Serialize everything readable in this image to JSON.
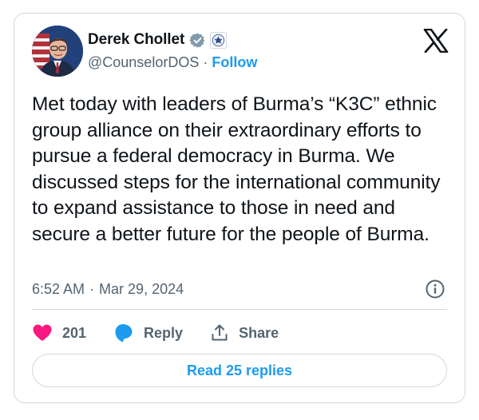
{
  "author": {
    "name": "Derek Chollet",
    "handle": "@CounselorDOS",
    "separator": "·",
    "follow_label": "Follow"
  },
  "icons": {
    "verified": "verified-badge-icon",
    "government": "government-seal-icon",
    "platform": "x-logo-icon",
    "info": "info-icon",
    "like": "heart-icon",
    "reply": "reply-bubble-icon",
    "share": "share-icon"
  },
  "tweet": {
    "text": "Met today with leaders of Burma’s “K3C” ethnic group alliance on their extraordinary efforts to pursue a federal democracy in Burma. We discussed steps for the international community to expand assistance to those in need and secure a better future for the people of Burma.",
    "time": "6:52 AM",
    "separator": "·",
    "date": "Mar 29, 2024"
  },
  "actions": {
    "like_count": "201",
    "reply_label": "Reply",
    "share_label": "Share"
  },
  "footer": {
    "read_replies_label": "Read 25 replies"
  },
  "colors": {
    "accent": "#1d9bf0",
    "like": "#f91880",
    "text": "#0f1419",
    "muted": "#536471",
    "border": "#cfd9de"
  }
}
